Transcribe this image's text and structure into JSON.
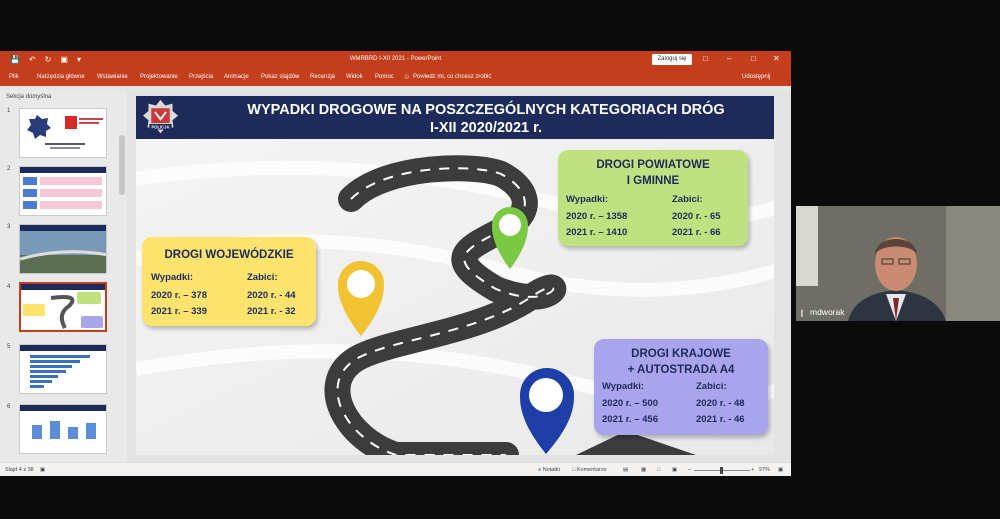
{
  "window": {
    "title": "WMRBRD I-XII 2021  -  PowerPoint",
    "sign_in": "Zaloguj się",
    "share": "Udostępnij"
  },
  "ribbon": {
    "tabs": [
      "Plik",
      "Narzędzia główne",
      "Wstawianie",
      "Projektowanie",
      "Przejścia",
      "Animacje",
      "Pokaz slajdów",
      "Recenzja",
      "Widok",
      "Pomoc"
    ],
    "tell_me": "Powiedz mi, co chcesz zrobić"
  },
  "thumbnails": {
    "section": "Sekcja domyślna",
    "numbers": [
      "1",
      "2",
      "3",
      "4",
      "5",
      "6"
    ],
    "active": 4
  },
  "slide": {
    "title_line1": "WYPADKI DROGOWE NA POSZCZEGÓLNYCH KATEGORIACH DRÓG",
    "title_line2": "I-XII 2020/2021 r.",
    "voivodeship": {
      "heading": "DROGI WOJEWÓDZKIE",
      "accidents_label": "Wypadki:",
      "killed_label": "Zabici:",
      "acc_2020": "2020 r. – 378",
      "acc_2021": "2021 r. – 339",
      "kill_2020": "2020 r. - 44",
      "kill_2021": "2021 r. - 32"
    },
    "district": {
      "heading1": "DROGI POWIATOWE",
      "heading2": "I GMINNE",
      "accidents_label": "Wypadki:",
      "killed_label": "Zabici:",
      "acc_2020": "2020 r. – 1358",
      "acc_2021": "2021 r. – 1410",
      "kill_2020": "2020 r. - 65",
      "kill_2021": "2021 r. - 66"
    },
    "national": {
      "heading1": "DROGI KRAJOWE",
      "heading2": "+ AUTOSTRADA A4",
      "accidents_label": "Wypadki:",
      "killed_label": "Zabici:",
      "acc_2020": "2020 r. – 500",
      "acc_2021": "2021 r. – 456",
      "kill_2020": "2020 r. - 48",
      "kill_2021": "2021 r. - 46"
    },
    "badge_text": "POLICJA"
  },
  "status": {
    "slide_info": "Slajd 4 z 38",
    "notes": "Notatki",
    "comments": "Komentarze",
    "zoom": "97%"
  },
  "camera": {
    "name": "mdworak"
  },
  "colors": {
    "ppt_accent": "#c43e1c",
    "header_navy": "#1c2b5a",
    "yellow_box": "#fbe36e",
    "green_box": "#bfe17f",
    "blue_box": "#a9a4ec"
  }
}
